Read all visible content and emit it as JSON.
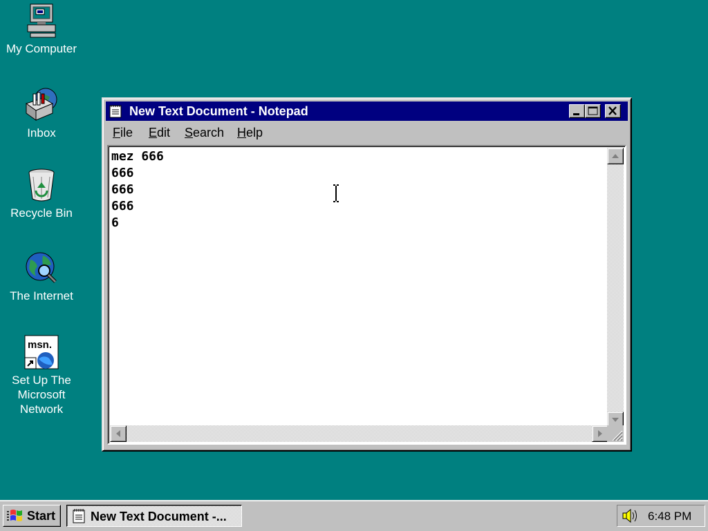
{
  "desktop": {
    "icons": [
      {
        "label": "My Computer"
      },
      {
        "label": "Inbox"
      },
      {
        "label": "Recycle Bin"
      },
      {
        "label": "The Internet"
      },
      {
        "label_lines": [
          "Set Up The",
          "Microsoft",
          "Network"
        ],
        "badge": "msn."
      }
    ]
  },
  "window": {
    "title": "New Text Document - Notepad",
    "menu": [
      {
        "label": "File",
        "accel": "F",
        "rest": "ile"
      },
      {
        "label": "Edit",
        "accel": "E",
        "rest": "dit"
      },
      {
        "label": "Search",
        "accel": "S",
        "rest": "earch"
      },
      {
        "label": "Help",
        "accel": "H",
        "rest": "elp"
      }
    ],
    "content": "mez 666\n666\n666\n666\n6",
    "controls": [
      "minimize-icon",
      "maximize-icon",
      "close-icon"
    ]
  },
  "taskbar": {
    "start_label": "Start",
    "task_label": "New Text Document -...",
    "clock": "6:48 PM",
    "tray_icons": [
      "speaker-icon"
    ]
  },
  "colors": {
    "desktop": "#008080",
    "titlebar": "#000080",
    "face": "#c0c0c0"
  }
}
